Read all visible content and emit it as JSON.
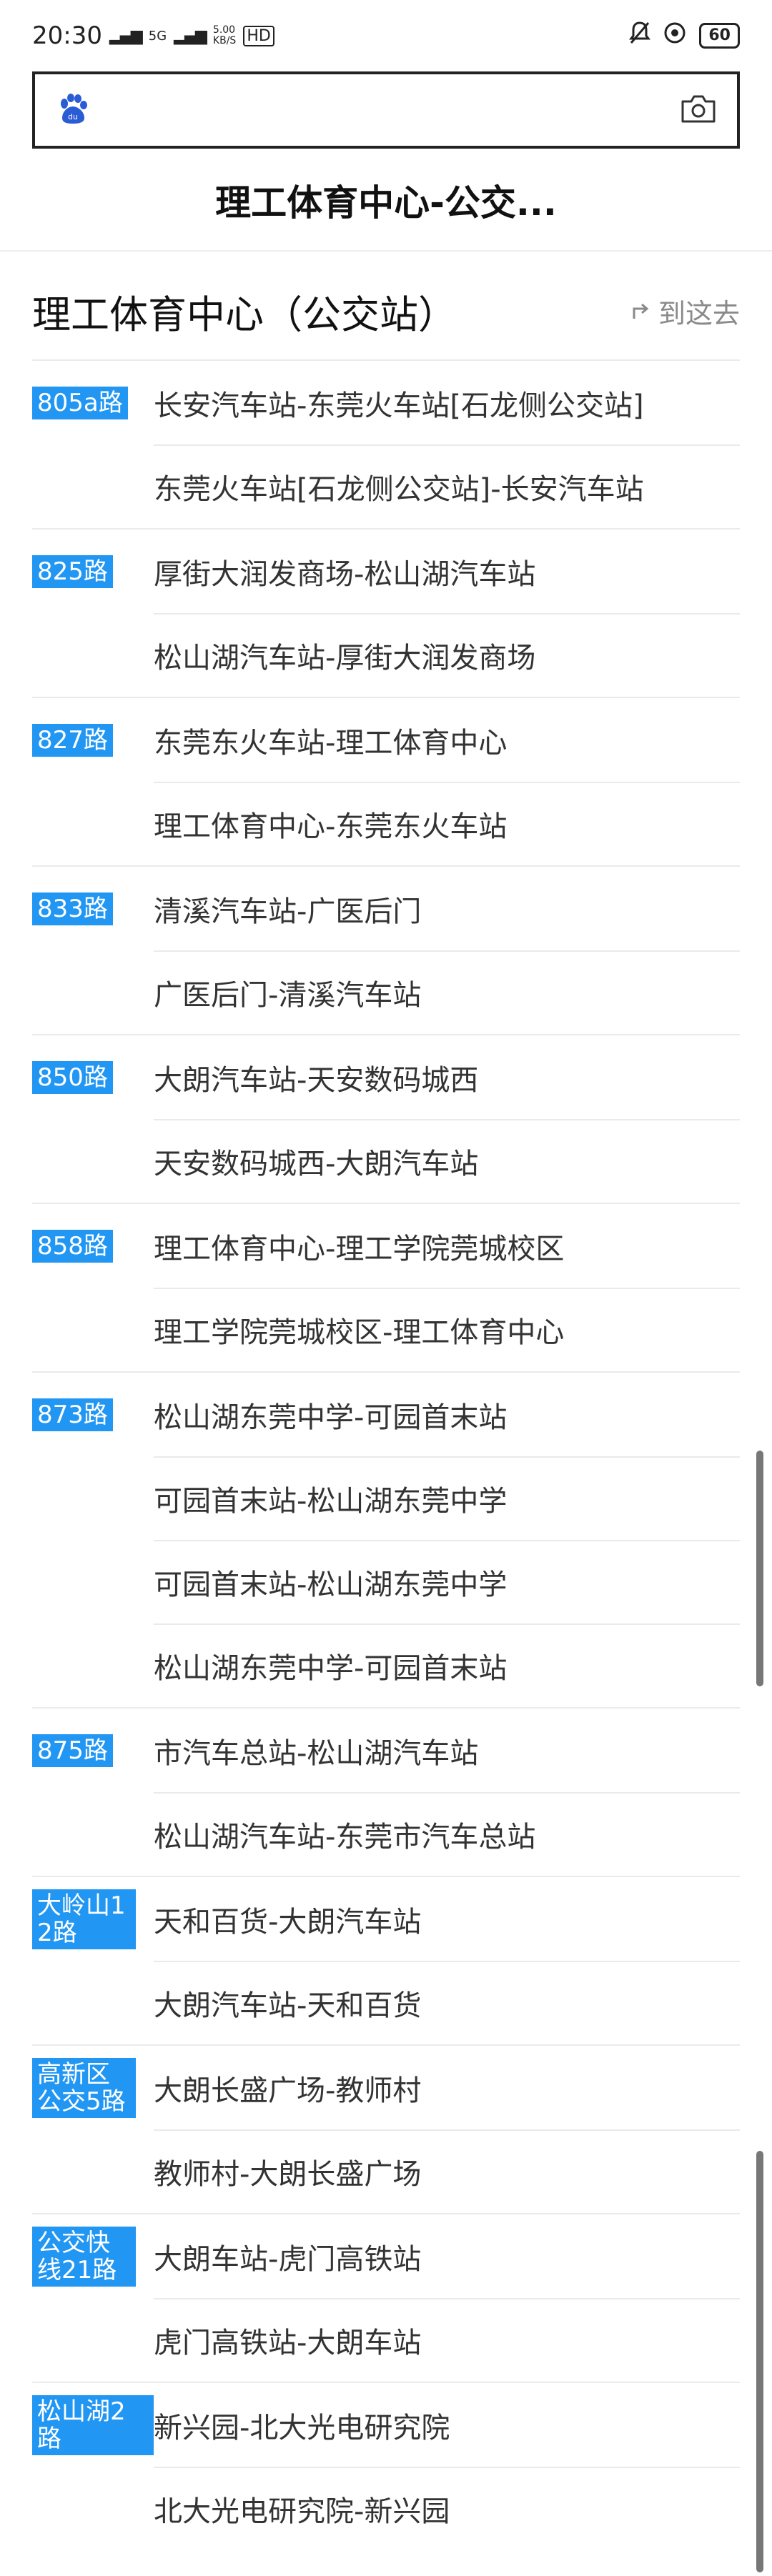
{
  "status_bar": {
    "time": "20:30",
    "network": "5G",
    "speed_value": "5.00",
    "speed_unit": "KB/S",
    "hd_label": "HD",
    "battery": "60"
  },
  "search": {
    "placeholder": ""
  },
  "header": {
    "title": "理工体育中心-公交..."
  },
  "station": {
    "name": "理工体育中心（公交站）",
    "go_here_label": "到这去"
  },
  "routes": [
    {
      "line": "805a路",
      "directions": [
        "长安汽车站-东莞火车站[石龙侧公交站]",
        "东莞火车站[石龙侧公交站]-长安汽车站"
      ]
    },
    {
      "line": "825路",
      "directions": [
        "厚街大润发商场-松山湖汽车站",
        "松山湖汽车站-厚街大润发商场"
      ]
    },
    {
      "line": "827路",
      "directions": [
        "东莞东火车站-理工体育中心",
        "理工体育中心-东莞东火车站"
      ]
    },
    {
      "line": "833路",
      "directions": [
        "清溪汽车站-广医后门",
        "广医后门-清溪汽车站"
      ]
    },
    {
      "line": "850路",
      "directions": [
        "大朗汽车站-天安数码城西",
        "天安数码城西-大朗汽车站"
      ]
    },
    {
      "line": "858路",
      "directions": [
        "理工体育中心-理工学院莞城校区",
        "理工学院莞城校区-理工体育中心"
      ]
    },
    {
      "line": "873路",
      "directions": [
        "松山湖东莞中学-可园首末站",
        "可园首末站-松山湖东莞中学",
        "可园首末站-松山湖东莞中学",
        "松山湖东莞中学-可园首末站"
      ]
    },
    {
      "line": "875路",
      "directions": [
        "市汽车总站-松山湖汽车站",
        "松山湖汽车站-东莞市汽车总站"
      ]
    },
    {
      "line": "大岭山12路",
      "directions": [
        "天和百货-大朗汽车站",
        "大朗汽车站-天和百货"
      ]
    },
    {
      "line": "高新区公交5路",
      "directions": [
        "大朗长盛广场-教师村",
        "教师村-大朗长盛广场"
      ]
    },
    {
      "line": "公交快线21路",
      "directions": [
        "大朗车站-虎门高铁站",
        "虎门高铁站-大朗车站"
      ]
    },
    {
      "line": "松山湖2路",
      "directions": [
        "新兴园-北大光电研究院",
        "北大光电研究院-新兴园"
      ]
    }
  ],
  "colors": {
    "badge": "#2196f3",
    "accent": "#2196f3"
  }
}
